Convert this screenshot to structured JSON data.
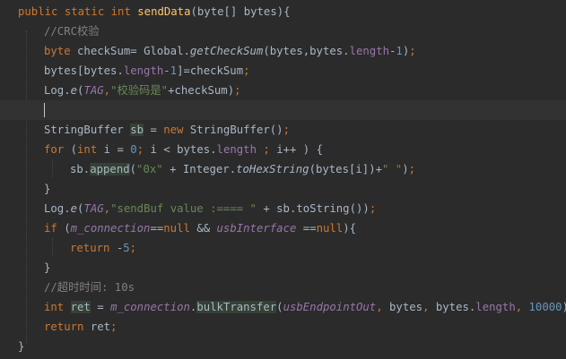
{
  "editor": {
    "current_line": 5,
    "lines": [
      [
        [
          "kw",
          "public static int "
        ],
        [
          "fn",
          "sendData"
        ],
        [
          "plain",
          "(byte[] bytes){"
        ]
      ],
      [
        [
          "cm",
          "//CRC校验"
        ]
      ],
      [
        [
          "kw",
          "byte "
        ],
        [
          "plain",
          "checkSum= Global."
        ],
        [
          "stat",
          "getCheckSum"
        ],
        [
          "plain",
          "(bytes,bytes."
        ],
        [
          "fld",
          "length"
        ],
        [
          "plain",
          "-"
        ],
        [
          "num",
          "1"
        ],
        [
          "plain",
          ")"
        ],
        [
          "kw",
          ";"
        ]
      ],
      [
        [
          "plain",
          "bytes[bytes."
        ],
        [
          "fld",
          "length"
        ],
        [
          "plain",
          "-"
        ],
        [
          "num",
          "1"
        ],
        [
          "plain",
          "]=checkSum"
        ],
        [
          "kw",
          ";"
        ]
      ],
      [
        [
          "plain",
          "Log."
        ],
        [
          "stat",
          "e"
        ],
        [
          "plain",
          "("
        ],
        [
          "fld it",
          "TAG"
        ],
        [
          "kw",
          ","
        ],
        [
          "str",
          "\"校验码是\""
        ],
        [
          "plain",
          "+checkSum)"
        ],
        [
          "kw",
          ";"
        ]
      ],
      [],
      [
        [
          "plain",
          "StringBuffer "
        ],
        [
          "hl",
          "sb"
        ],
        [
          "plain",
          " = "
        ],
        [
          "kw",
          "new "
        ],
        [
          "plain",
          "StringBuffer()"
        ],
        [
          "kw",
          ";"
        ]
      ],
      [
        [
          "kw",
          "for "
        ],
        [
          "plain",
          "("
        ],
        [
          "kw",
          "int "
        ],
        [
          "plain",
          "i = "
        ],
        [
          "num",
          "0"
        ],
        [
          "kw",
          "; "
        ],
        [
          "plain",
          "i < bytes."
        ],
        [
          "fld",
          "length "
        ],
        [
          "kw",
          "; "
        ],
        [
          "plain",
          "i++ ) {"
        ]
      ],
      [
        [
          "plain",
          "sb."
        ],
        [
          "hl",
          "append"
        ],
        [
          "plain",
          "("
        ],
        [
          "str",
          "\"0x\" "
        ],
        [
          "plain",
          "+ Integer."
        ],
        [
          "stat",
          "toHexString"
        ],
        [
          "plain",
          "(bytes[i])+"
        ],
        [
          "str",
          "\" \""
        ],
        [
          "plain",
          ")"
        ],
        [
          "kw",
          ";"
        ]
      ],
      [
        [
          "plain",
          "}"
        ]
      ],
      [
        [
          "plain",
          "Log."
        ],
        [
          "stat",
          "e"
        ],
        [
          "plain",
          "("
        ],
        [
          "fld it",
          "TAG"
        ],
        [
          "kw",
          ","
        ],
        [
          "str",
          "\"sendBuf value :==== \" "
        ],
        [
          "plain",
          "+ sb.toString())"
        ],
        [
          "kw",
          ";"
        ]
      ],
      [
        [
          "kw",
          "if "
        ],
        [
          "plain",
          "("
        ],
        [
          "fld it",
          "m_connection"
        ],
        [
          "plain",
          "=="
        ],
        [
          "kw",
          "null "
        ],
        [
          "plain",
          "&& "
        ],
        [
          "fld it",
          "usbInterface "
        ],
        [
          "plain",
          "=="
        ],
        [
          "kw",
          "null"
        ],
        [
          "plain",
          "){"
        ]
      ],
      [
        [
          "kw",
          "return "
        ],
        [
          "plain",
          "-"
        ],
        [
          "num",
          "5"
        ],
        [
          "kw",
          ";"
        ]
      ],
      [
        [
          "plain",
          "}"
        ]
      ],
      [
        [
          "cm",
          "//超时时间: 10s"
        ]
      ],
      [
        [
          "kw",
          "int "
        ],
        [
          "hl",
          "ret"
        ],
        [
          "plain",
          " = "
        ],
        [
          "fld it",
          "m_connection"
        ],
        [
          "plain",
          "."
        ],
        [
          "hl",
          "bulkTransfer"
        ],
        [
          "plain",
          "("
        ],
        [
          "fld it",
          "usbEndpointOut"
        ],
        [
          "kw",
          ", "
        ],
        [
          "plain",
          "bytes"
        ],
        [
          "kw",
          ", "
        ],
        [
          "plain",
          "bytes."
        ],
        [
          "fld",
          "length"
        ],
        [
          "kw",
          ", "
        ],
        [
          "num",
          "10000"
        ],
        [
          "plain",
          ")"
        ],
        [
          "kw",
          ";"
        ]
      ],
      [
        [
          "kw",
          "return "
        ],
        [
          "plain",
          "ret"
        ],
        [
          "kw",
          ";"
        ]
      ],
      [
        [
          "plain",
          "}"
        ]
      ]
    ]
  }
}
